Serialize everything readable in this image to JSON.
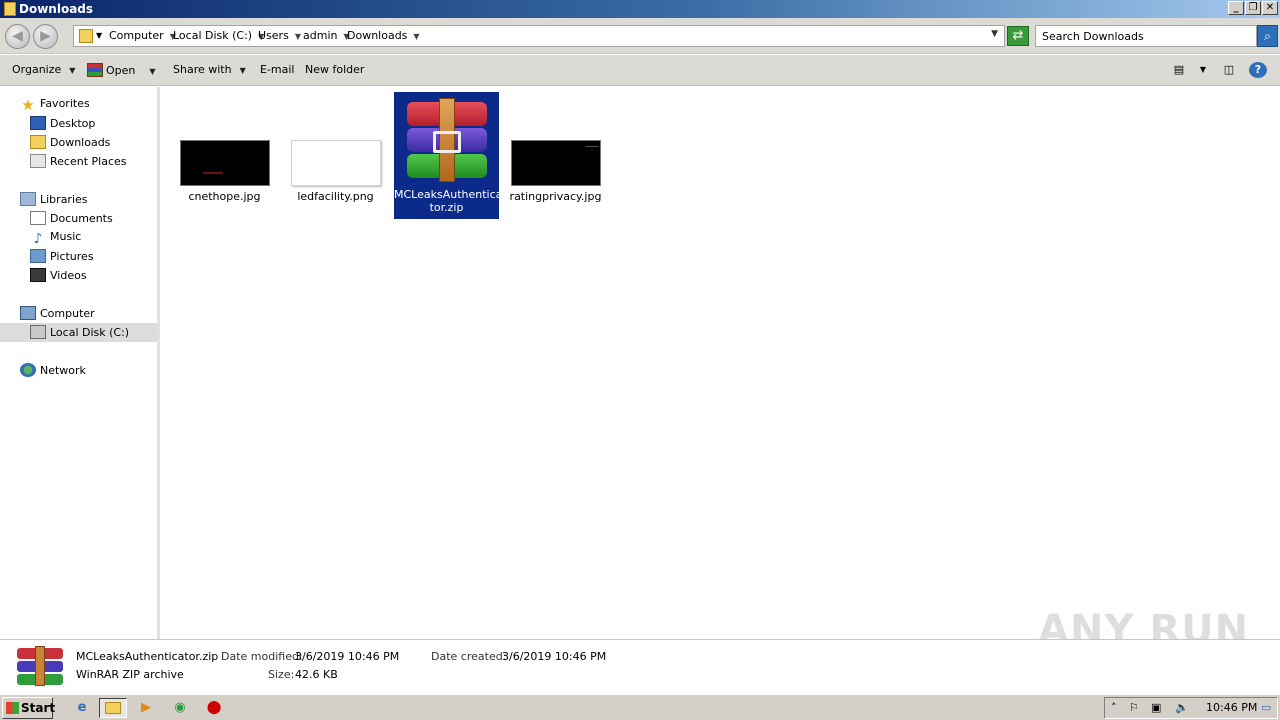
{
  "window": {
    "title": "Downloads"
  },
  "address": {
    "crumbs": [
      "Computer",
      "Local Disk (C:)",
      "Users",
      "admin",
      "Downloads"
    ],
    "search_placeholder": "Search Downloads"
  },
  "toolbar": {
    "organize": "Organize",
    "open": "Open",
    "share_with": "Share with",
    "email": "E-mail",
    "new_folder": "New folder"
  },
  "nav": {
    "favorites": "Favorites",
    "favorites_items": [
      "Desktop",
      "Downloads",
      "Recent Places"
    ],
    "libraries": "Libraries",
    "libraries_items": [
      "Documents",
      "Music",
      "Pictures",
      "Videos"
    ],
    "computer": "Computer",
    "computer_items": [
      "Local Disk (C:)"
    ],
    "network": "Network"
  },
  "files": [
    {
      "name": "cnethope.jpg",
      "thumb": "black"
    },
    {
      "name": "ledfacility.png",
      "thumb": "white"
    },
    {
      "name": "MCLeaksAuthentica tor.zip",
      "thumb": "winrar",
      "selected": true
    },
    {
      "name": "ratingprivacy.jpg",
      "thumb": "black"
    }
  ],
  "details": {
    "file_name": "MCLeaksAuthenticator.zip",
    "file_type": "WinRAR ZIP archive",
    "modified_label": "Date modified:",
    "modified_value": "3/6/2019 10:46 PM",
    "created_label": "Date created:",
    "created_value": "3/6/2019 10:46 PM",
    "size_label": "Size:",
    "size_value": "42.6 KB"
  },
  "watermark": "ANY RUN",
  "taskbar": {
    "start": "Start",
    "clock": "10:46 PM"
  },
  "colors": {
    "selection": "#0c2a8a",
    "title_start": "#0a246a",
    "title_end": "#a6caf0"
  }
}
